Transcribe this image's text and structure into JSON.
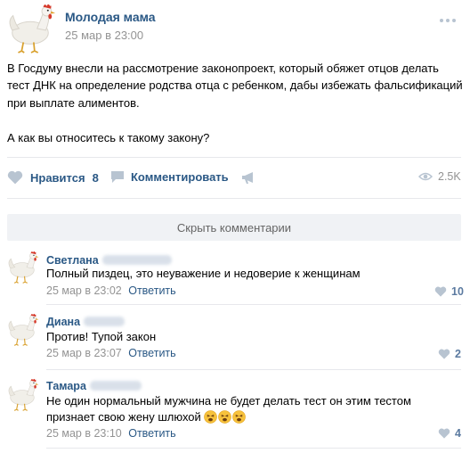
{
  "post": {
    "author": "Молодая мама",
    "time": "25 мар в 23:00",
    "text": "В Госдуму внесли на рассмотрение законопроект, который обяжет отцов делать тест ДНК на определение родства отца с ребенком, дабы избежать фальсификаций при выплате алиментов.",
    "question": "А как вы относитесь к такому закону?",
    "avatar_icon": "chicken-avatar"
  },
  "actions": {
    "like_label": "Нравится",
    "like_count": "8",
    "comment_label": "Комментировать",
    "share_icon": "megaphone-icon",
    "views": "2.5K"
  },
  "hide_comments_label": "Скрыть комментарии",
  "reply_label": "Ответить",
  "comments": [
    {
      "name": "Светлана",
      "text": "Полный пиздец, это неуважение и недоверие к женщинам",
      "date": "25 мар в 23:02",
      "likes": "10"
    },
    {
      "name": "Диана",
      "text": "Против! Тупой закон",
      "date": "25 мар в 23:07",
      "likes": "2"
    },
    {
      "name": "Тамара",
      "text": "Не один нормальный мужчина не будет делать тест он этим тестом признает свою жену шлюхой",
      "emoji": [
        "tired-face-emoji",
        "tired-face-emoji",
        "tired-face-emoji"
      ],
      "date": "25 мар в 23:10",
      "likes": "4"
    }
  ],
  "colors": {
    "link": "#2a5885",
    "muted": "#939393",
    "divider": "#e7e8ec",
    "bar_bg": "#f0f2f5",
    "icon": "#b8c4d1"
  }
}
